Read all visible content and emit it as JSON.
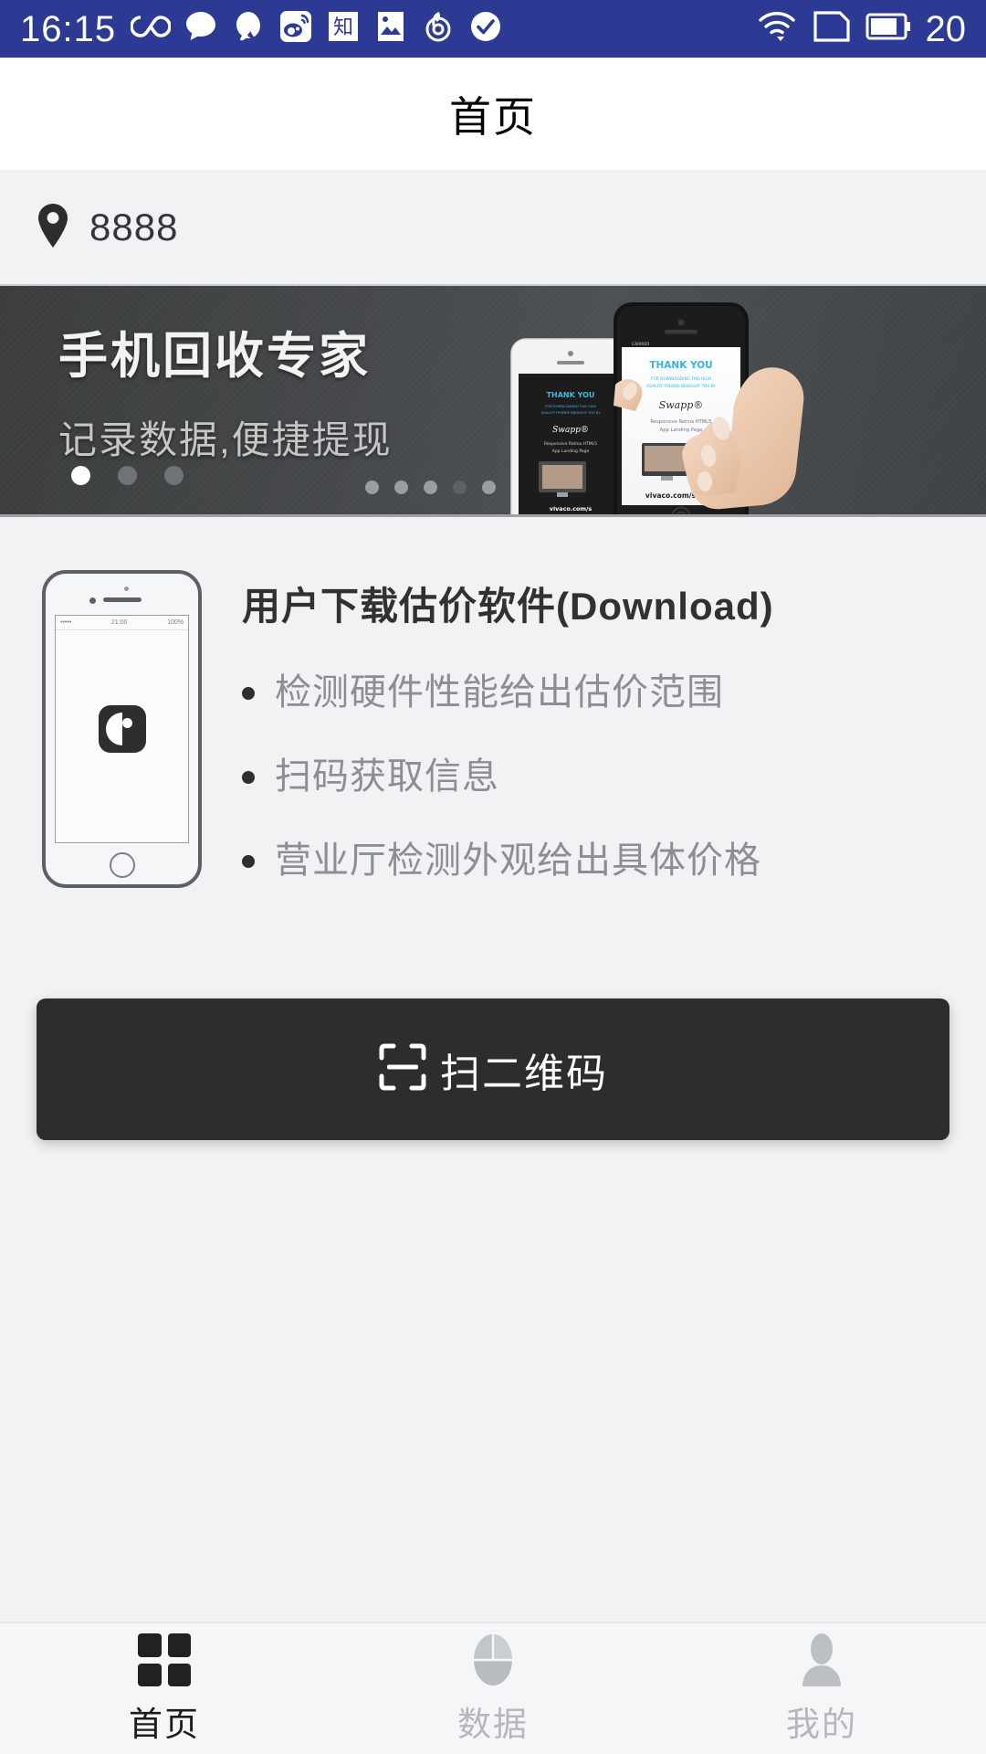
{
  "status_bar": {
    "time": "16:15",
    "battery_percent": "20",
    "left_icons": [
      "infinity-icon",
      "chat-bubble-icon",
      "qq-icon",
      "weibo-icon",
      "zhihu-icon",
      "photo-icon",
      "netease-music-icon",
      "check-circle-icon"
    ],
    "right_icons": [
      "wifi-download-icon",
      "sim-card-icon",
      "battery-icon"
    ],
    "background_color": "#2c3a94"
  },
  "header": {
    "title": "首页"
  },
  "location": {
    "icon": "map-pin-icon",
    "value": "8888"
  },
  "banner": {
    "title": "手机回收专家",
    "subtitle": "记录数据,便捷提现",
    "dots_total": 3,
    "dots_active_index": 0,
    "image_text": {
      "thank_you": "THANK YOU",
      "sub_line_1": "FOR DOWNLOADING THIS HIGH",
      "sub_line_2": "QUALITY FREEBIE BROUGHT YOU BY",
      "brand": "Swapp®",
      "desc_line_1": "Responsive Retina HTML5",
      "desc_line_2": "App Landing Page",
      "url": "vivaco.com/swapp",
      "carrier": "CARRIER"
    },
    "image_dots_total": 5,
    "image_dots_active_index": 3
  },
  "info": {
    "title": "用户下载估价软件(Download)",
    "bullets": [
      "检测硬件性能给出估价范围",
      "扫码获取信息",
      "营业厅检测外观给出具体价格"
    ],
    "phone_mock": {
      "status_time": "21:00",
      "status_battery": "100%",
      "status_signal": "•••••"
    }
  },
  "scan_button": {
    "label": "扫二维码",
    "icon": "scan-frame-icon",
    "background_color": "#2d2d2d"
  },
  "tabbar": {
    "items": [
      {
        "label": "首页",
        "icon": "grid-icon",
        "active": true
      },
      {
        "label": "数据",
        "icon": "pie-chart-icon",
        "active": false
      },
      {
        "label": "我的",
        "icon": "person-icon",
        "active": false
      }
    ]
  },
  "colors": {
    "page_background": "#f0f2f3",
    "accent_dark": "#2d2d2d",
    "status_bar": "#2c3a94",
    "muted_text": "#8b8f92"
  }
}
